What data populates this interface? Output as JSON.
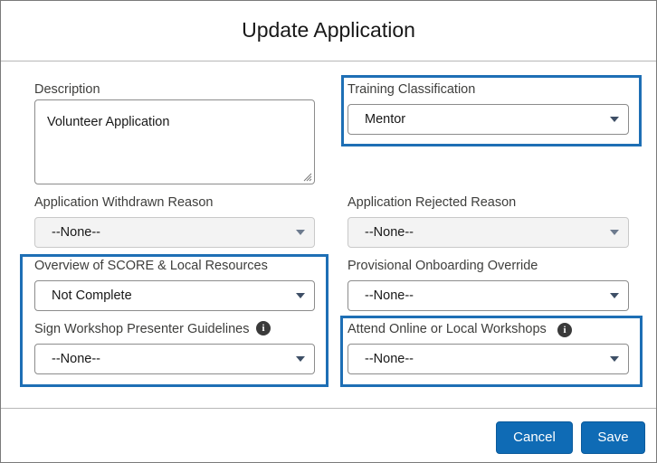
{
  "dialog": {
    "title": "Update Application"
  },
  "fields": {
    "description": {
      "label": "Description",
      "value": "Volunteer Application"
    },
    "training_classification": {
      "label": "Training Classification",
      "value": "Mentor"
    },
    "withdrawn_reason": {
      "label": "Application Withdrawn Reason",
      "value": "--None--"
    },
    "rejected_reason": {
      "label": "Application Rejected Reason",
      "value": "--None--"
    },
    "overview_score": {
      "label": "Overview of SCORE & Local Resources",
      "value": "Not Complete"
    },
    "provisional_override": {
      "label": "Provisional Onboarding Override",
      "value": "--None--"
    },
    "sign_guidelines": {
      "label": "Sign Workshop Presenter Guidelines",
      "value": "--None--"
    },
    "attend_workshops": {
      "label": "Attend Online or Local Workshops",
      "value": "--None--"
    }
  },
  "icons": {
    "info": "i"
  },
  "footer": {
    "cancel_label": "Cancel",
    "save_label": "Save"
  },
  "colors": {
    "highlight": "#1e6fb5",
    "button": "#0f6bb5",
    "disabled_bg": "#f3f3f3"
  }
}
